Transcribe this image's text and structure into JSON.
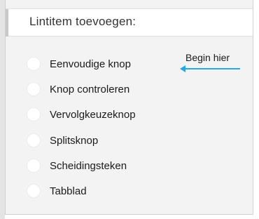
{
  "panel": {
    "title": "Lintitem toevoegen:"
  },
  "options": [
    {
      "label": "Eenvoudige knop"
    },
    {
      "label": "Knop controleren"
    },
    {
      "label": "Vervolgkeuzeknop"
    },
    {
      "label": "Splitsknop"
    },
    {
      "label": "Scheidingsteken"
    },
    {
      "label": "Tabblad"
    }
  ],
  "hint": {
    "text": "Begin hier",
    "arrow_color": "#2aa8de"
  }
}
